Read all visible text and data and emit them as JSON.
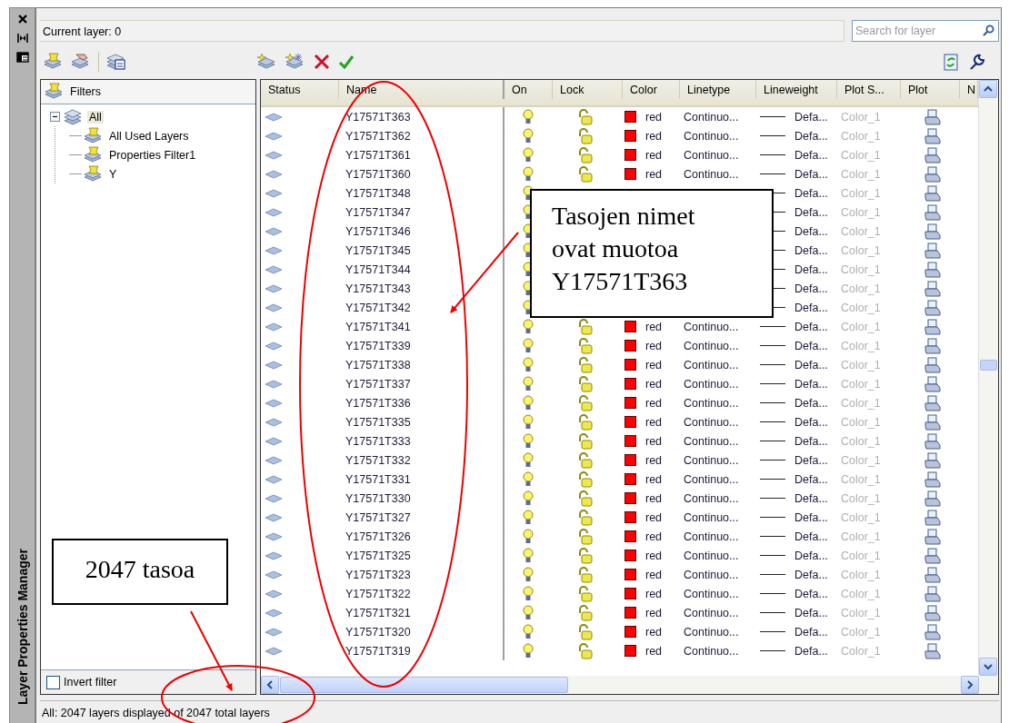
{
  "panel": {
    "title": "Layer Properties Manager"
  },
  "current_layer": "Current layer: 0",
  "search": {
    "placeholder": "Search for layer"
  },
  "filters": {
    "header": "Filters",
    "tree": [
      {
        "label": "All",
        "selected": true,
        "expanded": true,
        "children": [
          {
            "label": "All Used Layers",
            "selected": false
          },
          {
            "label": "Properties Filter1",
            "selected": false
          },
          {
            "label": "Y",
            "selected": false
          }
        ]
      }
    ],
    "invert_filter": {
      "label": "Invert filter",
      "checked": false
    }
  },
  "columns": [
    "Status",
    "Name",
    "On",
    "Lock",
    "Color",
    "Linetype",
    "Lineweight",
    "Plot S...",
    "Plot",
    "N"
  ],
  "rows": [
    {
      "name": "Y17571T363",
      "on": true,
      "locked": false,
      "color": "#ff0000",
      "color_name": "red",
      "linetype": "Continuo...",
      "lineweight": "Defa...",
      "plot_style": "Color_1",
      "plot": true
    },
    {
      "name": "Y17571T362",
      "on": true,
      "locked": false,
      "color": "#ff0000",
      "color_name": "red",
      "linetype": "Continuo...",
      "lineweight": "Defa...",
      "plot_style": "Color_1",
      "plot": true
    },
    {
      "name": "Y17571T361",
      "on": true,
      "locked": false,
      "color": "#ff0000",
      "color_name": "red",
      "linetype": "Continuo...",
      "lineweight": "Defa...",
      "plot_style": "Color_1",
      "plot": true
    },
    {
      "name": "Y17571T360",
      "on": true,
      "locked": false,
      "color": "#ff0000",
      "color_name": "red",
      "linetype": "Continuo...",
      "lineweight": "Defa...",
      "plot_style": "Color_1",
      "plot": true
    },
    {
      "name": "Y17571T348",
      "on": true,
      "lineweight": "Defa...",
      "plot_style": "Color_1",
      "plot": true
    },
    {
      "name": "Y17571T347",
      "on": true,
      "lineweight": "Defa...",
      "plot_style": "Color_1",
      "plot": true
    },
    {
      "name": "Y17571T346",
      "on": true,
      "lineweight": "Defa...",
      "plot_style": "Color_1",
      "plot": true
    },
    {
      "name": "Y17571T345",
      "on": true,
      "lineweight": "Defa...",
      "plot_style": "Color_1",
      "plot": true
    },
    {
      "name": "Y17571T344",
      "on": true,
      "lineweight": "Defa...",
      "plot_style": "Color_1",
      "plot": true
    },
    {
      "name": "Y17571T343",
      "on": true,
      "lineweight": "Defa...",
      "plot_style": "Color_1",
      "plot": true
    },
    {
      "name": "Y17571T342",
      "on": true,
      "lineweight": "Defa...",
      "plot_style": "Color_1",
      "plot": true
    },
    {
      "name": "Y17571T341",
      "on": true,
      "locked": false,
      "color": "#ff0000",
      "color_name": "red",
      "linetype": "Continuo...",
      "lineweight": "Defa...",
      "plot_style": "Color_1",
      "plot": true
    },
    {
      "name": "Y17571T339",
      "on": true,
      "locked": false,
      "color": "#ff0000",
      "color_name": "red",
      "linetype": "Continuo...",
      "lineweight": "Defa...",
      "plot_style": "Color_1",
      "plot": true
    },
    {
      "name": "Y17571T338",
      "on": true,
      "locked": false,
      "color": "#ff0000",
      "color_name": "red",
      "linetype": "Continuo...",
      "lineweight": "Defa...",
      "plot_style": "Color_1",
      "plot": true
    },
    {
      "name": "Y17571T337",
      "on": true,
      "locked": false,
      "color": "#ff0000",
      "color_name": "red",
      "linetype": "Continuo...",
      "lineweight": "Defa...",
      "plot_style": "Color_1",
      "plot": true
    },
    {
      "name": "Y17571T336",
      "on": true,
      "locked": false,
      "color": "#ff0000",
      "color_name": "red",
      "linetype": "Continuo...",
      "lineweight": "Defa...",
      "plot_style": "Color_1",
      "plot": true
    },
    {
      "name": "Y17571T335",
      "on": true,
      "locked": false,
      "color": "#ff0000",
      "color_name": "red",
      "linetype": "Continuo...",
      "lineweight": "Defa...",
      "plot_style": "Color_1",
      "plot": true
    },
    {
      "name": "Y17571T333",
      "on": true,
      "locked": false,
      "color": "#ff0000",
      "color_name": "red",
      "linetype": "Continuo...",
      "lineweight": "Defa...",
      "plot_style": "Color_1",
      "plot": true
    },
    {
      "name": "Y17571T332",
      "on": true,
      "locked": false,
      "color": "#ff0000",
      "color_name": "red",
      "linetype": "Continuo...",
      "lineweight": "Defa...",
      "plot_style": "Color_1",
      "plot": true
    },
    {
      "name": "Y17571T331",
      "on": true,
      "locked": false,
      "color": "#ff0000",
      "color_name": "red",
      "linetype": "Continuo...",
      "lineweight": "Defa...",
      "plot_style": "Color_1",
      "plot": true
    },
    {
      "name": "Y17571T330",
      "on": true,
      "locked": false,
      "color": "#ff0000",
      "color_name": "red",
      "linetype": "Continuo...",
      "lineweight": "Defa...",
      "plot_style": "Color_1",
      "plot": true
    },
    {
      "name": "Y17571T327",
      "on": true,
      "locked": false,
      "color": "#ff0000",
      "color_name": "red",
      "linetype": "Continuo...",
      "lineweight": "Defa...",
      "plot_style": "Color_1",
      "plot": true
    },
    {
      "name": "Y17571T326",
      "on": true,
      "locked": false,
      "color": "#ff0000",
      "color_name": "red",
      "linetype": "Continuo...",
      "lineweight": "Defa...",
      "plot_style": "Color_1",
      "plot": true
    },
    {
      "name": "Y17571T325",
      "on": true,
      "locked": false,
      "color": "#ff0000",
      "color_name": "red",
      "linetype": "Continuo...",
      "lineweight": "Defa...",
      "plot_style": "Color_1",
      "plot": true
    },
    {
      "name": "Y17571T323",
      "on": true,
      "locked": false,
      "color": "#ff0000",
      "color_name": "red",
      "linetype": "Continuo...",
      "lineweight": "Defa...",
      "plot_style": "Color_1",
      "plot": true
    },
    {
      "name": "Y17571T322",
      "on": true,
      "locked": false,
      "color": "#ff0000",
      "color_name": "red",
      "linetype": "Continuo...",
      "lineweight": "Defa...",
      "plot_style": "Color_1",
      "plot": true
    },
    {
      "name": "Y17571T321",
      "on": true,
      "locked": false,
      "color": "#ff0000",
      "color_name": "red",
      "linetype": "Continuo...",
      "lineweight": "Defa...",
      "plot_style": "Color_1",
      "plot": true
    },
    {
      "name": "Y17571T320",
      "on": true,
      "locked": false,
      "color": "#ff0000",
      "color_name": "red",
      "linetype": "Continuo...",
      "lineweight": "Defa...",
      "plot_style": "Color_1",
      "plot": true
    },
    {
      "name": "Y17571T319",
      "on": true,
      "locked": false,
      "color": "#ff0000",
      "color_name": "red",
      "linetype": "Continuo...",
      "lineweight": "Defa...",
      "plot_style": "Color_1",
      "plot": true
    }
  ],
  "status_bar": "All: 2047 layers displayed of 2047 total layers",
  "annotations": [
    {
      "kind": "callout",
      "text": "Tasojen nimet\novat muotoa\nY17571T363"
    },
    {
      "kind": "callout",
      "text": "2047 tasoa"
    }
  ]
}
